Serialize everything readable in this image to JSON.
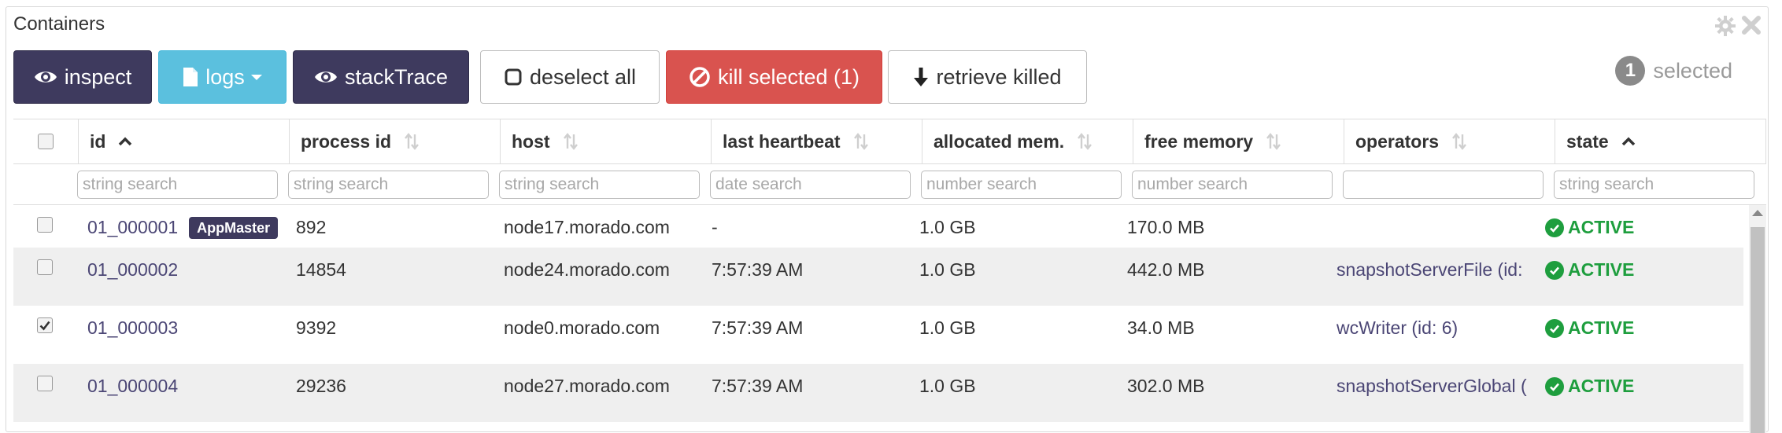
{
  "panel": {
    "title": "Containers"
  },
  "toolbar": {
    "inspect": "inspect",
    "logs": "logs",
    "stack_trace": "stackTrace",
    "deselect_all": "deselect all",
    "kill_selected": "kill selected (1)",
    "retrieve_killed": "retrieve killed"
  },
  "selection": {
    "count": "1",
    "label": "selected"
  },
  "columns": [
    {
      "label": "id",
      "sort": "asc"
    },
    {
      "label": "process id",
      "sort": "none"
    },
    {
      "label": "host",
      "sort": "none"
    },
    {
      "label": "last heartbeat",
      "sort": "none"
    },
    {
      "label": "allocated mem.",
      "sort": "none"
    },
    {
      "label": "free memory",
      "sort": "none"
    },
    {
      "label": "operators",
      "sort": "none"
    },
    {
      "label": "state",
      "sort": "asc"
    }
  ],
  "filters": {
    "id": "string search",
    "process_id": "string search",
    "host": "string search",
    "last_heartbeat": "date search",
    "allocated_mem": "number search",
    "free_memory": "number search",
    "operators": "",
    "state": "string search"
  },
  "rows": [
    {
      "checked": false,
      "id": "01_000001",
      "badge": "AppMaster",
      "process_id": "892",
      "host": "node17.morado.com",
      "last_heartbeat": "-",
      "allocated_mem": "1.0 GB",
      "free_memory": "170.0 MB",
      "operators": "",
      "state": "ACTIVE"
    },
    {
      "checked": false,
      "id": "01_000002",
      "badge": "",
      "process_id": "14854",
      "host": "node24.morado.com",
      "last_heartbeat": "7:57:39 AM",
      "allocated_mem": "1.0 GB",
      "free_memory": "442.0 MB",
      "operators": "snapshotServerFile (id:",
      "state": "ACTIVE"
    },
    {
      "checked": true,
      "id": "01_000003",
      "badge": "",
      "process_id": "9392",
      "host": "node0.morado.com",
      "last_heartbeat": "7:57:39 AM",
      "allocated_mem": "1.0 GB",
      "free_memory": "34.0 MB",
      "operators": "wcWriter (id: 6)",
      "state": "ACTIVE"
    },
    {
      "checked": false,
      "id": "01_000004",
      "badge": "",
      "process_id": "29236",
      "host": "node27.morado.com",
      "last_heartbeat": "7:57:39 AM",
      "allocated_mem": "1.0 GB",
      "free_memory": "302.0 MB",
      "operators": "snapshotServerGlobal (",
      "state": "ACTIVE"
    }
  ],
  "colors": {
    "dark": "#3e3a5e",
    "info": "#5bc0de",
    "danger": "#d9534f",
    "active": "#1e9e3e",
    "link": "#4b4675"
  }
}
